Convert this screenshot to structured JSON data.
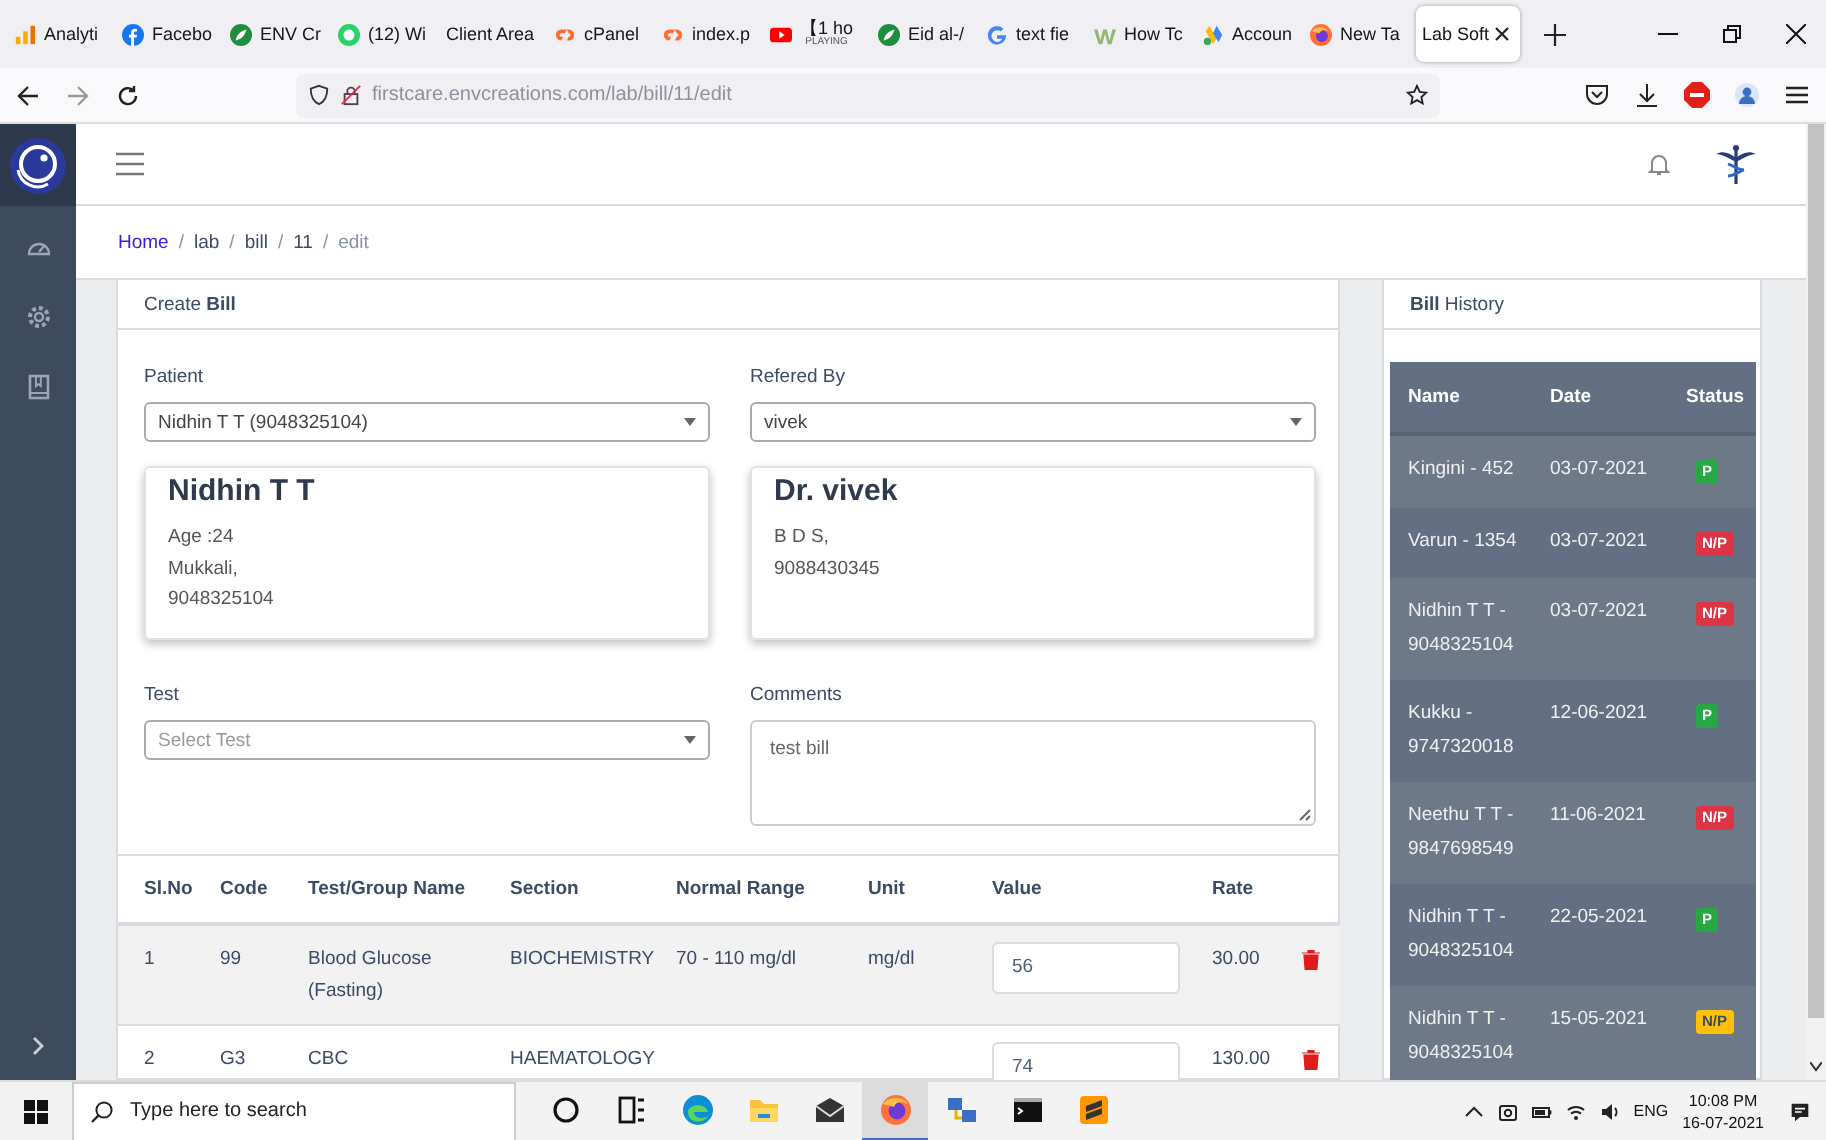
{
  "browser": {
    "tabs": [
      {
        "label": "Analyti",
        "kind": "bars",
        "selected": false
      },
      {
        "label": "Facebo",
        "kind": "fb",
        "selected": false
      },
      {
        "label": "ENV Cr",
        "kind": "leaf",
        "selected": false
      },
      {
        "label": "(12) Wi",
        "kind": "wa",
        "selected": false
      },
      {
        "label": "Client Area",
        "kind": "none",
        "selected": false
      },
      {
        "label": "cPanel",
        "kind": "cp",
        "selected": false
      },
      {
        "label": "index.p",
        "kind": "cp",
        "selected": false
      },
      {
        "label": "【1 ho",
        "sub": "PLAYING",
        "kind": "yt",
        "selected": false
      },
      {
        "label": "Eid al-/",
        "kind": "leaf",
        "selected": false
      },
      {
        "label": "text fie",
        "kind": "g",
        "selected": false
      },
      {
        "label": "How Tc",
        "kind": "w",
        "selected": false
      },
      {
        "label": "Accoun",
        "kind": "ads",
        "selected": false
      },
      {
        "label": "New Ta",
        "kind": "fx",
        "selected": false
      },
      {
        "label": "Lab Soft",
        "kind": "none",
        "selected": true
      }
    ],
    "url": "firstcare.envcreations.com/lab/bill/11/edit"
  },
  "breadcrumb": [
    {
      "label": "Home",
      "kind": "link"
    },
    {
      "separator": "/",
      "label": "lab",
      "kind": "text"
    },
    {
      "separator": "/",
      "label": "bill",
      "kind": "text"
    },
    {
      "separator": "/",
      "label": "11",
      "kind": "text"
    },
    {
      "separator": "/",
      "label": "edit",
      "kind": "current"
    }
  ],
  "bill_form": {
    "title": "Create **Bill**",
    "patient": {
      "label": "Patient",
      "value": "Nidhin T T (9048325104)"
    },
    "referred_by": {
      "label": "Refered By",
      "value": "vivek"
    },
    "patient_card": {
      "name": "Nidhin T T",
      "lines": [
        "Age :24",
        "Mukkali,",
        "9048325104"
      ]
    },
    "doctor_card": {
      "name": "Dr. vivek",
      "lines": [
        "B D S,",
        "9088430345"
      ]
    },
    "test": {
      "label": "Test",
      "placeholder": "Select Test"
    },
    "comments": {
      "label": "Comments",
      "value": "test bill"
    },
    "table": {
      "columns": [
        "Sl.No",
        "Code",
        "Test/Group Name",
        "Section",
        "Normal Range",
        "Unit",
        "Value",
        "Rate"
      ],
      "rows": [
        {
          "sl": "1",
          "code": "99",
          "name": "Blood Glucose (Fasting)",
          "section": "BIOCHEMISTRY",
          "range": "70 - 110 mg/dl",
          "unit": "mg/dl",
          "value": "56",
          "rate": "30.00"
        },
        {
          "sl": "2",
          "code": "G3",
          "name": "CBC",
          "section": "HAEMATOLOGY",
          "value": "74",
          "rate": "130.00"
        }
      ]
    }
  },
  "bill_history": {
    "title": "**Bill** History",
    "columns": [
      "Name",
      "Date",
      "Status"
    ],
    "rows": [
      {
        "name": "Kingini - 452",
        "date": "03-07-2021",
        "status": "P",
        "color": "#28a745"
      },
      {
        "name": "Varun - 1354",
        "date": "03-07-2021",
        "status": "N/P",
        "color": "#dc3545"
      },
      {
        "name": "Nidhin T T - 9048325104",
        "date": "03-07-2021",
        "status": "N/P",
        "color": "#dc3545"
      },
      {
        "name": "Kukku - 9747320018",
        "date": "12-06-2021",
        "status": "P",
        "color": "#28a745"
      },
      {
        "name": "Neethu T T - 9847698549",
        "date": "11-06-2021",
        "status": "N/P",
        "color": "#dc3545"
      },
      {
        "name": "Nidhin T T - 9048325104",
        "date": "22-05-2021",
        "status": "P",
        "color": "#28a745"
      },
      {
        "name": "Nidhin T T - 9048325104",
        "date": "15-05-2021",
        "status": "N/P",
        "color": "#ffc107"
      }
    ]
  },
  "taskbar": {
    "search_placeholder": "Type here to search",
    "apps": [
      {
        "kind": "circle",
        "selected": false
      },
      {
        "kind": "taskview",
        "selected": false
      },
      {
        "kind": "edge",
        "selected": false
      },
      {
        "kind": "folder",
        "selected": false
      },
      {
        "kind": "mail",
        "selected": false
      },
      {
        "kind": "fx",
        "selected": true
      },
      {
        "kind": "network",
        "selected": false
      },
      {
        "kind": "terminal",
        "selected": false
      },
      {
        "kind": "sublime",
        "selected": false
      }
    ],
    "language": "ENG",
    "time": "10:08 PM",
    "date": "16-07-2021"
  }
}
